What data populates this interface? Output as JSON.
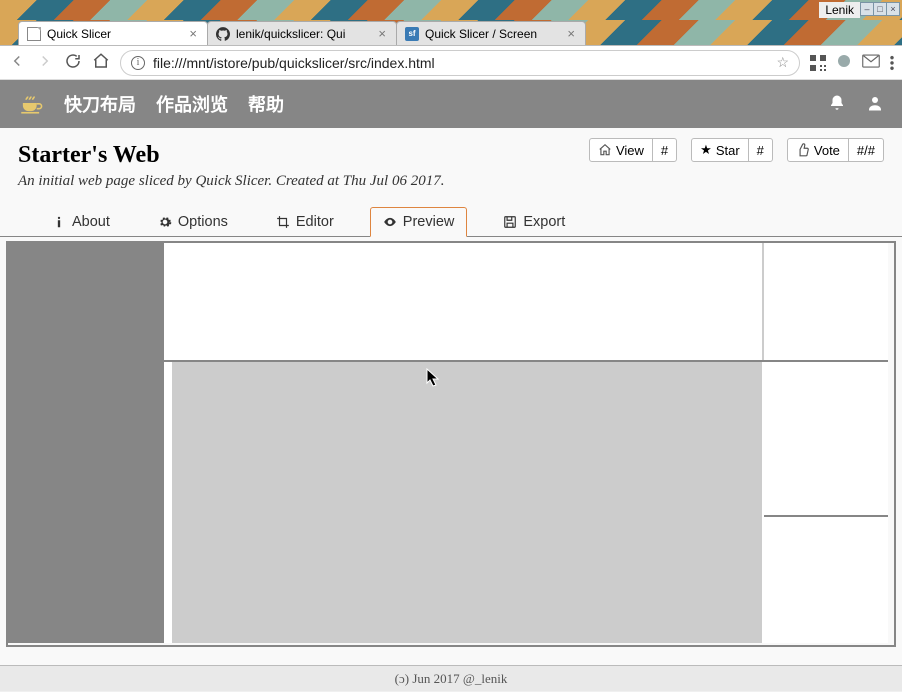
{
  "window": {
    "title": "Lenik"
  },
  "browser_tabs": [
    {
      "label": "Quick Slicer",
      "title_full": "Quick Slicer"
    },
    {
      "label": "lenik/quickslicer: Qui",
      "title_full": "lenik/quickslicer: Quick Slicer"
    },
    {
      "label": "Quick Slicer / Screen",
      "title_full": "Quick Slicer / Screenshots"
    }
  ],
  "address_bar": {
    "url": "file:///mnt/istore/pub/quickslicer/src/index.html"
  },
  "navbar": {
    "items": [
      "快刀布局",
      "作品浏览",
      "帮助"
    ]
  },
  "page": {
    "title": "Starter's Web",
    "subtitle": "An initial web page sliced by Quick Slicer. Created at Thu Jul 06 2017."
  },
  "stats": {
    "view": {
      "label": "View",
      "count": "#"
    },
    "star": {
      "label": "Star",
      "count": "#"
    },
    "vote": {
      "label": "Vote",
      "count": "#/#"
    }
  },
  "view_tabs": {
    "about": {
      "label": "About"
    },
    "options": {
      "label": "Options"
    },
    "editor": {
      "label": "Editor"
    },
    "preview": {
      "label": "Preview"
    },
    "export": {
      "label": "Export"
    }
  },
  "footer": {
    "text": "(ɔ) Jun 2017 @_lenik"
  }
}
